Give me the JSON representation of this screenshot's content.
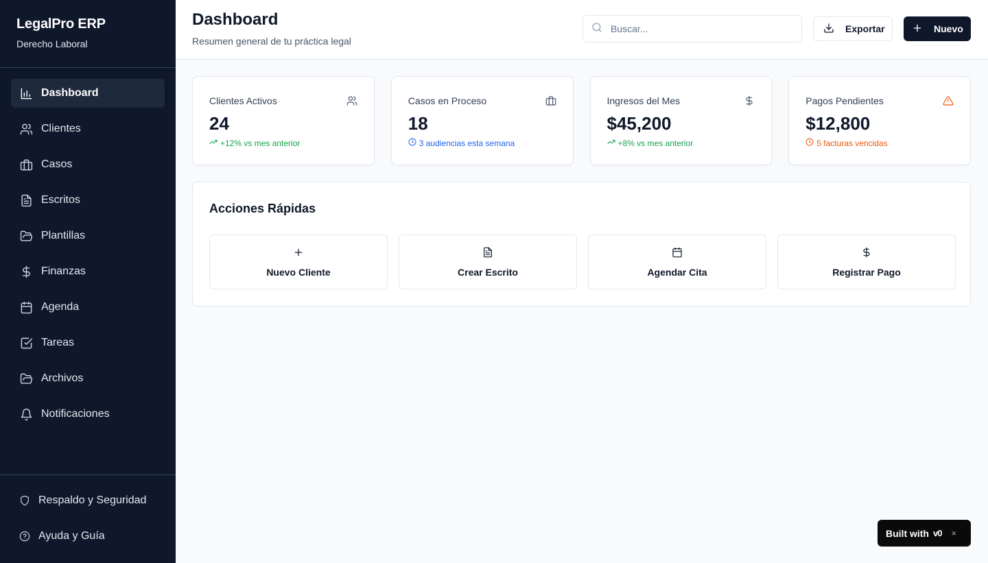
{
  "sidebar": {
    "brand_title": "LegalPro ERP",
    "brand_subtitle": "Derecho Laboral",
    "items": [
      {
        "label": "Dashboard",
        "icon": "bar-chart-icon",
        "active": true
      },
      {
        "label": "Clientes",
        "icon": "users-icon"
      },
      {
        "label": "Casos",
        "icon": "briefcase-icon"
      },
      {
        "label": "Escritos",
        "icon": "file-text-icon"
      },
      {
        "label": "Plantillas",
        "icon": "folder-open-icon"
      },
      {
        "label": "Finanzas",
        "icon": "dollar-icon"
      },
      {
        "label": "Agenda",
        "icon": "calendar-icon"
      },
      {
        "label": "Tareas",
        "icon": "check-square-icon"
      },
      {
        "label": "Archivos",
        "icon": "folder-icon"
      },
      {
        "label": "Notificaciones",
        "icon": "bell-icon"
      }
    ],
    "bottom": [
      {
        "label": "Respaldo y Seguridad",
        "icon": "shield-icon"
      },
      {
        "label": "Ayuda y Guía",
        "icon": "help-circle-icon"
      }
    ]
  },
  "header": {
    "title": "Dashboard",
    "subtitle": "Resumen general de tu práctica legal",
    "search_placeholder": "Buscar...",
    "export_label": "Exportar",
    "new_label": "Nuevo"
  },
  "stats": [
    {
      "title": "Clientes Activos",
      "value": "24",
      "note": "+12% vs mes anterior",
      "icon": "users-icon",
      "note_icon": "trending-up-icon",
      "note_color": "#16a34a",
      "icon_color": "#475569"
    },
    {
      "title": "Casos en Proceso",
      "value": "18",
      "note": "3 audiencias esta semana",
      "icon": "briefcase-icon",
      "note_icon": "clock-icon",
      "note_color": "#2563eb",
      "icon_color": "#475569"
    },
    {
      "title": "Ingresos del Mes",
      "value": "$45,200",
      "note": "+8% vs mes anterior",
      "icon": "dollar-icon",
      "note_icon": "trending-up-icon",
      "note_color": "#16a34a",
      "icon_color": "#475569"
    },
    {
      "title": "Pagos Pendientes",
      "value": "$12,800",
      "note": "5 facturas vencidas",
      "icon": "alert-triangle-icon",
      "note_icon": "clock-icon",
      "note_color": "#ea580c",
      "icon_color": "#ea580c"
    }
  ],
  "quick_actions": {
    "title": "Acciones Rápidas",
    "items": [
      {
        "label": "Nuevo Cliente",
        "icon": "plus-icon"
      },
      {
        "label": "Crear Escrito",
        "icon": "file-text-icon"
      },
      {
        "label": "Agendar Cita",
        "icon": "calendar-icon"
      },
      {
        "label": "Registrar Pago",
        "icon": "dollar-icon"
      }
    ]
  },
  "badge": {
    "label": "Built with",
    "logo": "v0",
    "close": "×"
  }
}
